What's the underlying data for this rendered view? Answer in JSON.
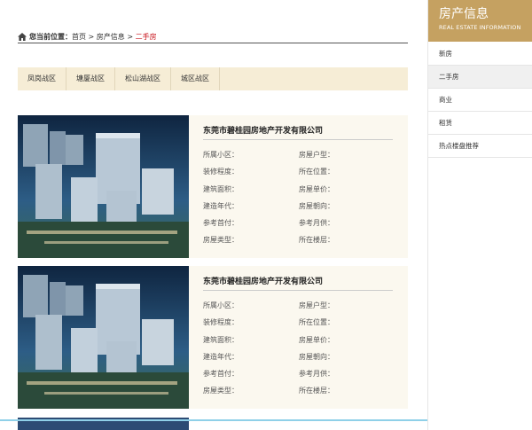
{
  "breadcrumb": {
    "label": "您当前位置：",
    "home": "首页",
    "sep1": " > ",
    "section": "房产信息",
    "sep2": " > ",
    "current": "二手房"
  },
  "districts": [
    "凤岗战区",
    "塘厦战区",
    "松山湖战区",
    "城区战区"
  ],
  "listings": [
    {
      "company": "东莞市碧桂园房地产开发有限公司",
      "fields": [
        "所属小区：",
        "房屋户型：",
        "装修程度：",
        "所在位置：",
        "建筑面积：",
        "房屋单价：",
        "建造年代：",
        "房屋朝向：",
        "参考首付：",
        "参考月供：",
        "房屋类型：",
        "所在楼层："
      ]
    },
    {
      "company": "东莞市碧桂园房地产开发有限公司",
      "fields": [
        "所属小区：",
        "房屋户型：",
        "装修程度：",
        "所在位置：",
        "建筑面积：",
        "房屋单价：",
        "建造年代：",
        "房屋朝向：",
        "参考首付：",
        "参考月供：",
        "房屋类型：",
        "所在楼层："
      ]
    }
  ],
  "sidebar": {
    "title": "房产信息",
    "subtitle": "REAL ESTATE INFORMATION",
    "items": [
      "新房",
      "二手房",
      "商业",
      "租赁",
      "热点楼盘推荐"
    ],
    "active_index": 1
  },
  "colors": {
    "accent": "#c5a161",
    "current_crumb": "#c8161d",
    "district_bar": "#f6edd6",
    "card_bg": "#fbf8ef"
  }
}
